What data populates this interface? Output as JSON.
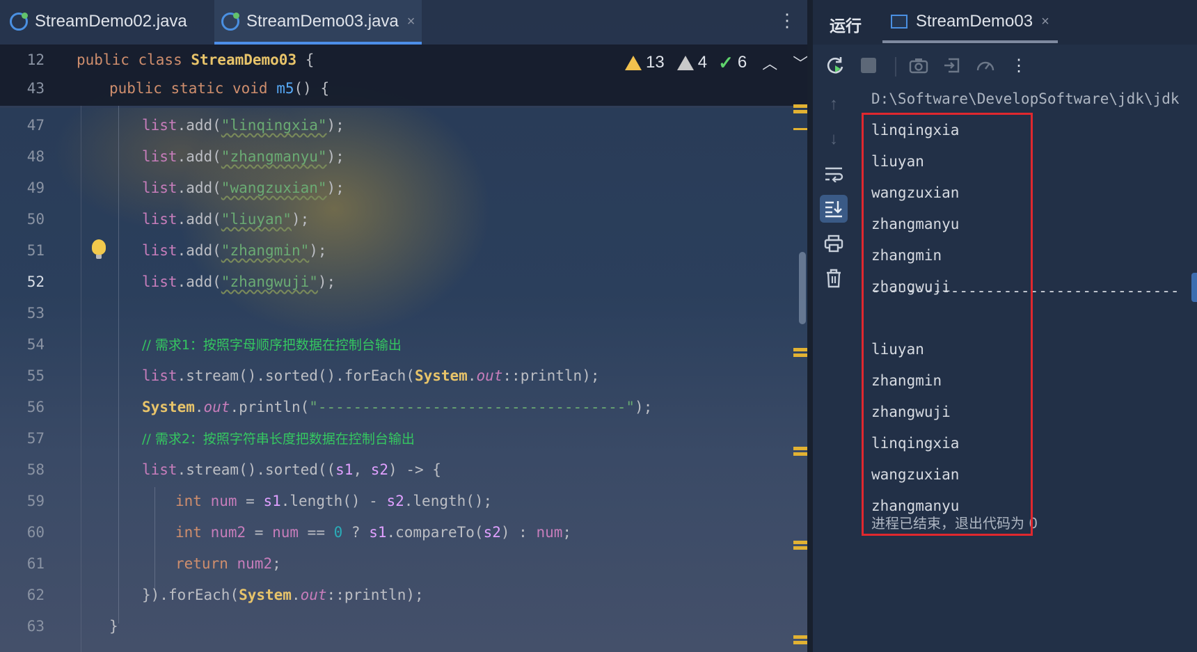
{
  "editor": {
    "tabs": [
      {
        "label": "StreamDemo02.java",
        "active": false
      },
      {
        "label": "StreamDemo03.java",
        "active": true
      }
    ],
    "tab_close": "×",
    "more": "⋮",
    "sticky": [
      {
        "num": "12",
        "parts": [
          [
            "kw",
            "public class "
          ],
          [
            "cls",
            "StreamDemo03"
          ],
          [
            "plain",
            " {"
          ]
        ]
      },
      {
        "num": "43",
        "parts": [
          [
            "kw",
            "public static void "
          ],
          [
            "fn",
            "m5"
          ],
          [
            "plain",
            "() {"
          ]
        ]
      }
    ],
    "inspections": {
      "warnings": "13",
      "weak_warnings": "4",
      "ok": "6"
    },
    "lines": [
      {
        "num": "47",
        "parts": [
          [
            "var",
            "list"
          ],
          [
            "plain",
            ".add("
          ],
          [
            "strU",
            "\"linqingxia\""
          ],
          [
            "plain",
            ");"
          ]
        ]
      },
      {
        "num": "48",
        "parts": [
          [
            "var",
            "list"
          ],
          [
            "plain",
            ".add("
          ],
          [
            "strU",
            "\"zhangmanyu\""
          ],
          [
            "plain",
            ");"
          ]
        ]
      },
      {
        "num": "49",
        "parts": [
          [
            "var",
            "list"
          ],
          [
            "plain",
            ".add("
          ],
          [
            "strU",
            "\"wangzuxian\""
          ],
          [
            "plain",
            ");"
          ]
        ]
      },
      {
        "num": "50",
        "parts": [
          [
            "var",
            "list"
          ],
          [
            "plain",
            ".add("
          ],
          [
            "strU",
            "\"liuyan\""
          ],
          [
            "plain",
            ");"
          ]
        ]
      },
      {
        "num": "51",
        "parts": [
          [
            "var",
            "list"
          ],
          [
            "plain",
            ".add("
          ],
          [
            "strU",
            "\"zhangmin\""
          ],
          [
            "plain",
            ");"
          ]
        ]
      },
      {
        "num": "52",
        "parts": [
          [
            "var",
            "list"
          ],
          [
            "plain",
            ".add("
          ],
          [
            "strU",
            "\"zhangwuji\""
          ],
          [
            "plain",
            ");"
          ]
        ]
      },
      {
        "num": "53",
        "parts": []
      },
      {
        "num": "54",
        "parts": [
          [
            "cmt",
            "// 需求1：按照字母顺序把数据在控制台输出"
          ]
        ]
      },
      {
        "num": "55",
        "parts": [
          [
            "var",
            "list"
          ],
          [
            "plain",
            ".stream().sorted().forEach("
          ],
          [
            "cls",
            "System"
          ],
          [
            "plain",
            "."
          ],
          [
            "fld",
            "out"
          ],
          [
            "plain",
            "::println);"
          ]
        ]
      },
      {
        "num": "56",
        "parts": [
          [
            "cls",
            "System"
          ],
          [
            "plain",
            "."
          ],
          [
            "fld",
            "out"
          ],
          [
            "plain",
            ".println("
          ],
          [
            "str",
            "\"-----------------------------------\""
          ],
          [
            "plain",
            ");"
          ]
        ]
      },
      {
        "num": "57",
        "parts": [
          [
            "cmt",
            "// 需求2：按照字符串长度把数据在控制台输出"
          ]
        ]
      },
      {
        "num": "58",
        "parts": [
          [
            "var",
            "list"
          ],
          [
            "plain",
            ".stream().sorted(("
          ],
          [
            "param",
            "s1"
          ],
          [
            "plain",
            ", "
          ],
          [
            "param",
            "s2"
          ],
          [
            "plain",
            ") -> {"
          ]
        ]
      },
      {
        "num": "59",
        "parts": [
          [
            "kw",
            "int "
          ],
          [
            "var",
            "num"
          ],
          [
            "plain",
            " = "
          ],
          [
            "param",
            "s1"
          ],
          [
            "plain",
            ".length() - "
          ],
          [
            "param",
            "s2"
          ],
          [
            "plain",
            ".length();"
          ]
        ]
      },
      {
        "num": "60",
        "parts": [
          [
            "kw",
            "int "
          ],
          [
            "var",
            "num2"
          ],
          [
            "plain",
            " = "
          ],
          [
            "var",
            "num"
          ],
          [
            "plain",
            " == "
          ],
          [
            "num",
            "0"
          ],
          [
            "plain",
            " ? "
          ],
          [
            "param",
            "s1"
          ],
          [
            "plain",
            ".compareTo("
          ],
          [
            "param",
            "s2"
          ],
          [
            "plain",
            ") : "
          ],
          [
            "var",
            "num"
          ],
          [
            "plain",
            ";"
          ]
        ]
      },
      {
        "num": "61",
        "parts": [
          [
            "kw",
            "return "
          ],
          [
            "var",
            "num2"
          ],
          [
            "plain",
            ";"
          ]
        ]
      },
      {
        "num": "62",
        "parts": [
          [
            "plain",
            "})."
          ],
          [
            "plain",
            "forEach("
          ],
          [
            "cls",
            "System"
          ],
          [
            "plain",
            "."
          ],
          [
            "fld",
            "out"
          ],
          [
            "plain",
            "::println);"
          ]
        ]
      },
      {
        "num": "63",
        "parts": [
          [
            "plain",
            "}"
          ]
        ]
      }
    ]
  },
  "run": {
    "title": "运行",
    "tab_label": "StreamDemo03",
    "tab_close": "×",
    "path": "D:\\Software\\DevelopSoftware\\jdk\\jdk",
    "output_first": [
      "linqingxia",
      "liuyan",
      "wangzuxian",
      "zhangmanyu",
      "zhangmin",
      "zhangwuji"
    ],
    "separator": "-----------------------------------",
    "output_second": [
      "liuyan",
      "zhangmin",
      "zhangwuji",
      "linqingxia",
      "wangzuxian",
      "zhangmanyu"
    ],
    "exit_message": "进程已结束，退出代码为 0"
  }
}
